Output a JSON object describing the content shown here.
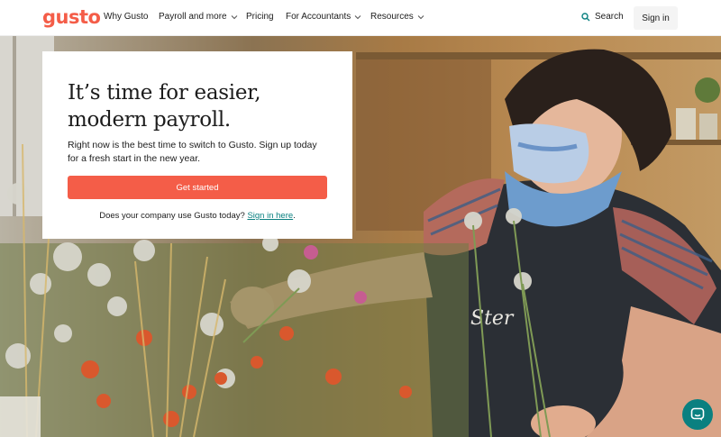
{
  "brand": {
    "logo_text": "gusto",
    "accent": "#f45d48",
    "link_color": "#0a8080"
  },
  "nav": {
    "items": [
      {
        "label": "Why Gusto",
        "has_dropdown": false
      },
      {
        "label": "Payroll and more",
        "has_dropdown": true
      },
      {
        "label": "Pricing",
        "has_dropdown": false
      },
      {
        "label": "For Accountants",
        "has_dropdown": true
      },
      {
        "label": "Resources",
        "has_dropdown": true
      }
    ],
    "search_label": "Search",
    "signin_label": "Sign in"
  },
  "hero": {
    "title_line1": "It’s time for easier,",
    "title_line2": "modern payroll.",
    "subtitle": "Right now is the best time to switch to Gusto. Sign up today for a fresh start in the new year.",
    "cta_label": "Get started",
    "footer_text": "Does your company use Gusto today?",
    "footer_link": "Sign in here",
    "footer_suffix": "."
  },
  "chat": {
    "icon": "chat-bubble-icon"
  }
}
